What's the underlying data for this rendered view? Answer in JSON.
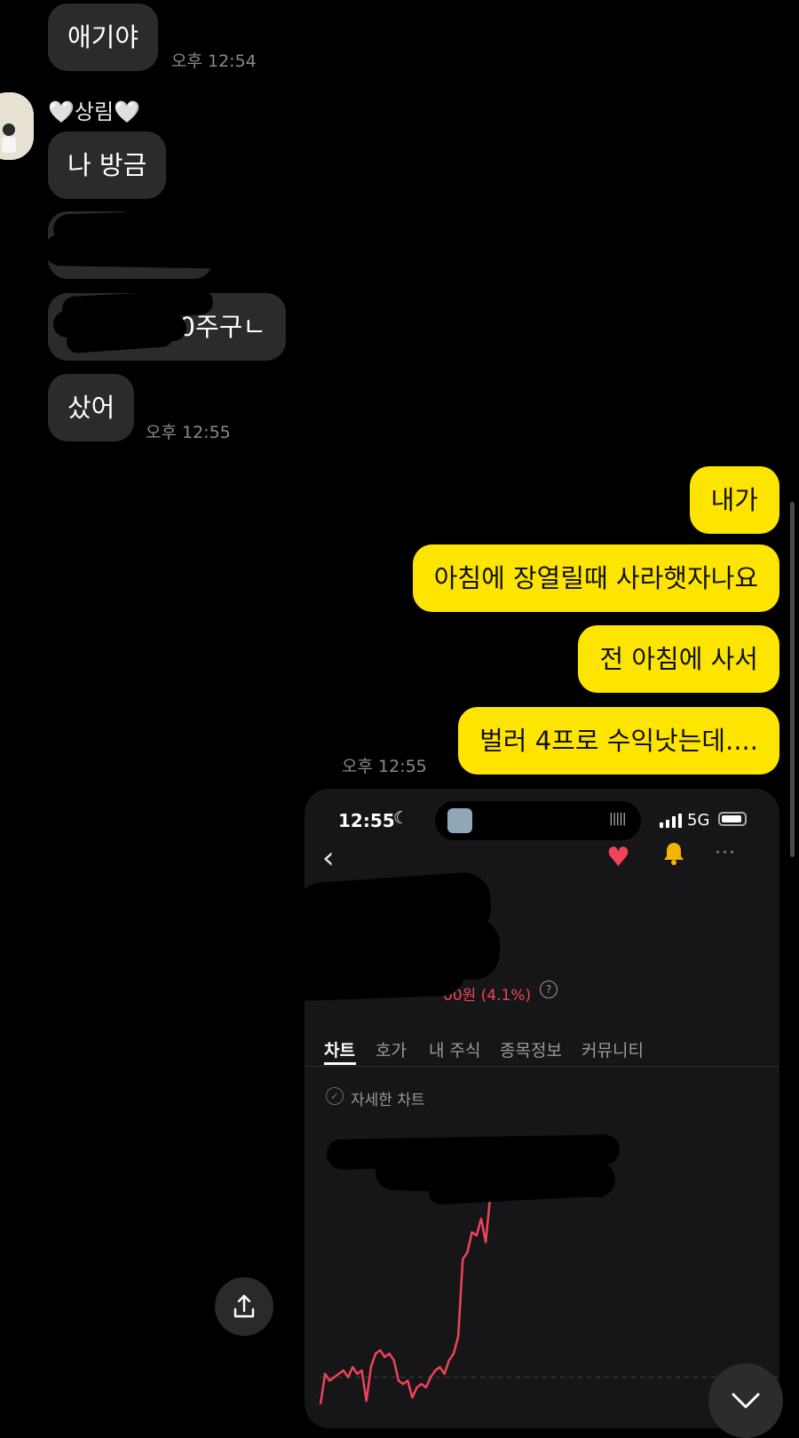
{
  "incoming": {
    "sender_name": "🤍상림🤍",
    "messages": [
      "애기야",
      "나 방금",
      "",
      "",
      "샀어"
    ],
    "visible_partial_text": "00주구ㄴ",
    "times": [
      "오후 12:54",
      "오후 12:55"
    ]
  },
  "outgoing": {
    "messages": [
      "내가",
      "아침에 장열릴때 사라햇자나요",
      "전 아침에 사서",
      "벌러 4프로 수익낫는데...."
    ],
    "time": "오후 12:55"
  },
  "screenshot": {
    "status_time": "12:55",
    "network": "5G",
    "change_text": "00원 (4.1%)",
    "tabs": [
      "차트",
      "호가",
      "내 주식",
      "종목정보",
      "커뮤니티"
    ],
    "active_tab": "차트",
    "detail_chart_label": "자세한 차트",
    "colors": {
      "up": "#f0445a",
      "heart": "#f0445a",
      "bell": "#f5b400"
    },
    "chart_data": {
      "type": "line",
      "series": [
        {
          "values": [
            0.05,
            0.14,
            0.12,
            0.13,
            0.14,
            0.15,
            0.13,
            0.16,
            0.14,
            0.15,
            0.06,
            0.16,
            0.2,
            0.21,
            0.19,
            0.2,
            0.18,
            0.12,
            0.11,
            0.12,
            0.07,
            0.1,
            0.11,
            0.1,
            0.13,
            0.15,
            0.16,
            0.14,
            0.18,
            0.2,
            0.25,
            0.48,
            0.5,
            0.56,
            0.55,
            0.6,
            0.53,
            0.67,
            0.74,
            0.8,
            0.74,
            0.7
          ]
        }
      ],
      "baseline": 0.13
    }
  }
}
